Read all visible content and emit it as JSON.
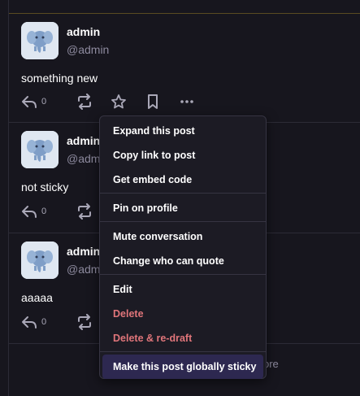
{
  "posts": [
    {
      "display_name": "admin",
      "handle": "@admin",
      "text": "something new",
      "reply_count": "0"
    },
    {
      "display_name": "admin",
      "handle": "@admin",
      "text": "not sticky",
      "reply_count": "0"
    },
    {
      "display_name": "admin",
      "handle": "@admin",
      "text": "aaaaa",
      "reply_count": "0"
    }
  ],
  "footer": {
    "show_more": "ore"
  },
  "menu": {
    "items": [
      {
        "label": "Expand this post"
      },
      {
        "label": "Copy link to post"
      },
      {
        "label": "Get embed code"
      },
      {
        "label": "Pin on profile"
      },
      {
        "label": "Mute conversation"
      },
      {
        "label": "Change who can quote"
      },
      {
        "label": "Edit"
      },
      {
        "label": "Delete"
      },
      {
        "label": "Delete & re-draft"
      },
      {
        "label": "Make this post globally sticky"
      }
    ]
  },
  "colors": {
    "background": "#17161e",
    "menu_background": "#1c1b24",
    "danger": "#e0757a",
    "highlight": "#2d2850",
    "muted": "#8d8a9e"
  }
}
